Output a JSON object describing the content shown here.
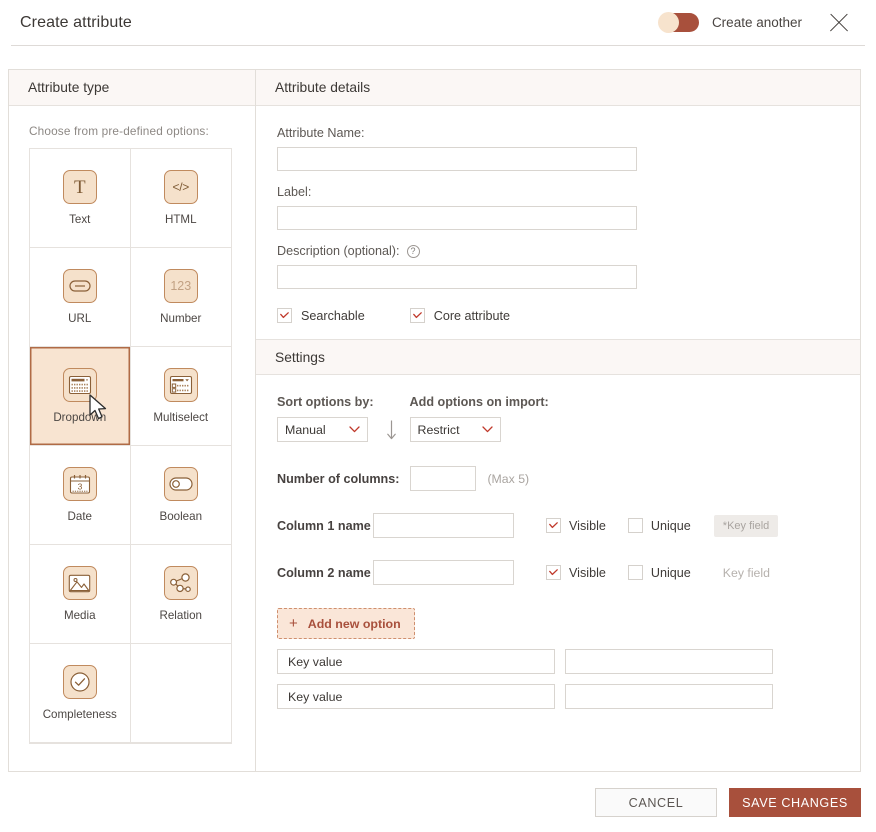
{
  "topbar": {
    "title": "Create attribute",
    "toggle_label": "Create another",
    "close_icon": "close-icon"
  },
  "left_panel": {
    "header": "Attribute type",
    "choose_label": "Choose  from  pre-defined options:",
    "tiles": [
      {
        "label": "Text",
        "icon": "text-icon",
        "selected": false
      },
      {
        "label": "HTML",
        "icon": "html-icon",
        "selected": false
      },
      {
        "label": "URL",
        "icon": "url-icon",
        "selected": false
      },
      {
        "label": "Number",
        "icon": "number-icon",
        "selected": false
      },
      {
        "label": "Dropdown",
        "icon": "dropdown-icon",
        "selected": true
      },
      {
        "label": "Multiselect",
        "icon": "multiselect-icon",
        "selected": false
      },
      {
        "label": "Date",
        "icon": "date-icon",
        "selected": false
      },
      {
        "label": "Boolean",
        "icon": "boolean-icon",
        "selected": false
      },
      {
        "label": "Media",
        "icon": "media-icon",
        "selected": false
      },
      {
        "label": "Relation",
        "icon": "relation-icon",
        "selected": false
      },
      {
        "label": "Completeness",
        "icon": "completeness-icon",
        "selected": false
      }
    ]
  },
  "details": {
    "header": "Attribute details",
    "attribute_name_label": "Attribute Name:",
    "attribute_name_value": "",
    "label_label": "Label:",
    "label_value": "",
    "description_label": "Description (optional):",
    "description_help_icon": "help-icon",
    "description_value": "",
    "searchable_label": "Searchable",
    "searchable_checked": true,
    "core_attribute_label": "Core attribute",
    "core_attribute_checked": true
  },
  "settings": {
    "header": "Settings",
    "sort_options_label": "Sort options by:",
    "sort_options_value": "Manual",
    "sort_direction_icon": "arrow-down-icon",
    "add_options_label": "Add options on import:",
    "add_options_value": "Restrict",
    "number_of_columns_label": "Number of columns:",
    "number_of_columns_value": "",
    "max_hint": "(Max 5)",
    "columns": [
      {
        "name_label": "Column 1 name",
        "name_value": "",
        "visible_label": "Visible",
        "visible_checked": true,
        "unique_label": "Unique",
        "unique_checked": false,
        "key_field_text": "*Key field",
        "key_field_badge": true
      },
      {
        "name_label": "Column 2 name",
        "name_value": "",
        "visible_label": "Visible",
        "visible_checked": true,
        "unique_label": "Unique",
        "unique_checked": false,
        "key_field_text": "Key field",
        "key_field_badge": false
      }
    ],
    "add_new_option_label": "Add new option",
    "add_new_option_icon": "plus-icon",
    "option_rows": [
      {
        "key_placeholder": "Key value",
        "value": ""
      },
      {
        "key_placeholder": "Key value",
        "value": ""
      }
    ]
  },
  "footer": {
    "cancel_label": "CANCEL",
    "save_label": "SAVE CHANGES"
  },
  "colors": {
    "accent": "#a8503c",
    "selected_tile_bg": "#f8e4d1",
    "panel_header_bg": "#fbf7f5",
    "icon_bg": "#f5e1cb",
    "icon_border": "#c08a5e"
  }
}
